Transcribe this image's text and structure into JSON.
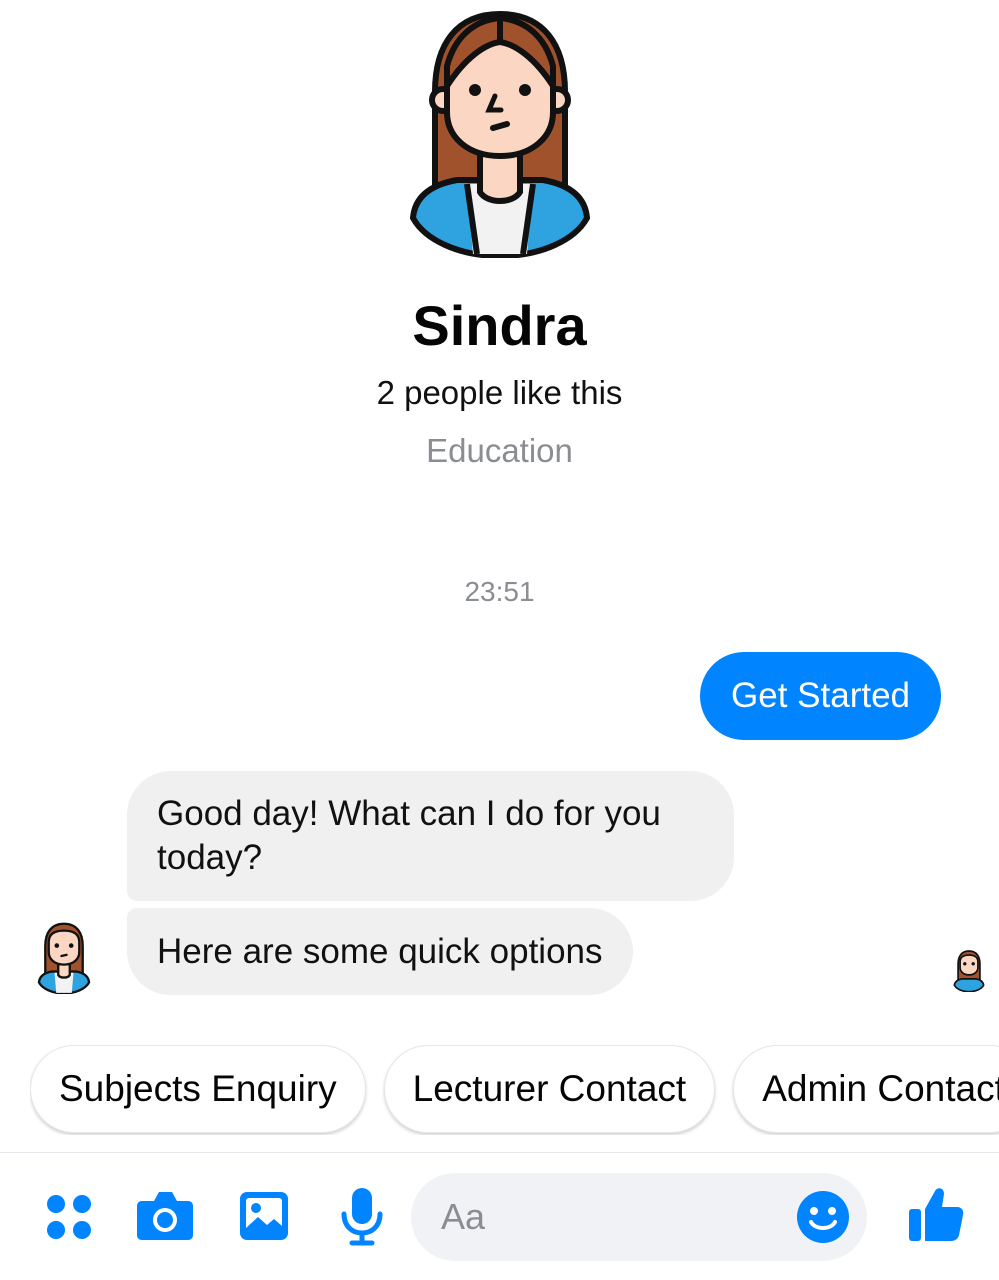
{
  "profile": {
    "name": "Sindra",
    "likes": "2 people like this",
    "category": "Education"
  },
  "conversation": {
    "timestamp": "23:51",
    "messages": [
      {
        "from": "user",
        "text": "Get Started"
      },
      {
        "from": "page",
        "text": "Good day! What can I do for you today?"
      },
      {
        "from": "page",
        "text": "Here are some quick options"
      }
    ]
  },
  "quick_replies": [
    "Subjects Enquiry",
    "Lecturer Contact",
    "Admin Contact"
  ],
  "composer": {
    "placeholder": "Aa",
    "icons": [
      "more-actions-icon",
      "camera-icon",
      "gallery-icon",
      "microphone-icon",
      "emoji-icon",
      "thumbs-up-icon"
    ]
  },
  "colors": {
    "accent": "#0084ff",
    "incoming_bubble": "#f0f0f0",
    "muted_text": "#8a8d91"
  }
}
